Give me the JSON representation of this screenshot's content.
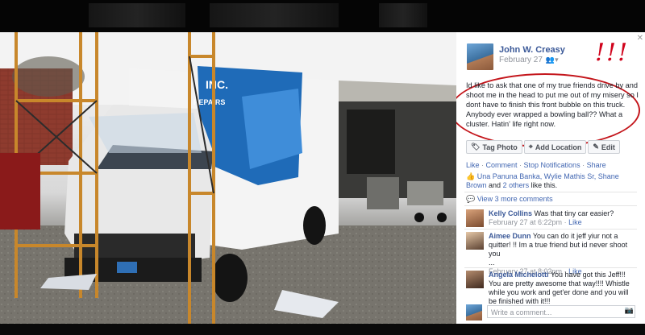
{
  "post": {
    "author": "John W. Creasy",
    "date": "February 27",
    "privacy_icon": "friends-icon",
    "annotation": "!!!",
    "text": "Id like to ask that one of my true friends drive by and shoot me in the head to put me out of my misery so I dont have to finish this front bubble on this truck. Anybody ever wrapped a bowling ball?? What a cluster. Hatin' life right now."
  },
  "actions": {
    "tag_photo": "Tag Photo",
    "add_location": "Add Location",
    "edit": "Edit"
  },
  "links": {
    "like": "Like",
    "comment": "Comment",
    "stop_notifications": "Stop Notifications",
    "share": "Share",
    "sep": " · "
  },
  "likes": {
    "names": "Una Panuna Banka, Wylie Mathis Sr, Shane Brown",
    "and": "and",
    "others": "2 others",
    "suffix": "like this."
  },
  "view_more": "View 3 more comments",
  "comments": [
    {
      "name": "Kelly Collins",
      "text": "Was that tiny car easier?",
      "time": "February 27 at 6:22pm",
      "like": "Like"
    },
    {
      "name": "Aimee Dunn",
      "text": "You can do it jeff yiur not a quitter! !! Im a true friend but id never shoot you",
      "extra": "...",
      "time": "February 27 at 8:02pm",
      "like": "Like"
    },
    {
      "name": "Angela Michelotti",
      "text": "You have got this Jeff!!! You are pretty awesome that way!!!! Whistle while you work and get'er done and you will be finished with it!!!",
      "time": "",
      "like": ""
    }
  ],
  "write_comment_placeholder": "Write a comment...",
  "colors": {
    "link": "#3b5998",
    "annotation": "#c4161c"
  }
}
